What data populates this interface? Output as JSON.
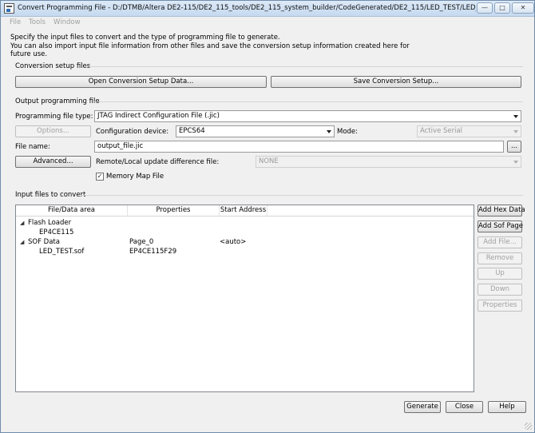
{
  "window": {
    "title": "Convert Programming File - D:/DTMB/Altera DE2-115/DE2_115_tools/DE2_115_system_builder/CodeGenerated/DE2_115/LED_TEST/LED_TEST - LED_T...",
    "minimize": "—",
    "maximize": "□",
    "close": "✕"
  },
  "menu": [
    "File",
    "Tools",
    "Window"
  ],
  "intro": [
    "Specify the input files to convert and the type of programming file to generate.",
    "You can also import input file information from other files and save the conversion setup information created here for",
    "future use."
  ],
  "conversion_setup": {
    "label": "Conversion setup files",
    "open_button": "Open Conversion Setup Data...",
    "save_button": "Save Conversion Setup..."
  },
  "output": {
    "label": "Output programming file",
    "file_type_label": "Programming file type:",
    "file_type_value": "JTAG Indirect Configuration File (.jic)",
    "options_button": "Options...",
    "config_device_label": "Configuration device:",
    "config_device_value": "EPCS64",
    "mode_label": "Mode:",
    "mode_value": "Active Serial",
    "file_name_label": "File name:",
    "file_name_value": "output_file.jic",
    "browse_button": "...",
    "advanced_button": "Advanced...",
    "remote_label": "Remote/Local update difference file:",
    "remote_value": "NONE",
    "memory_map_label": "Memory Map File",
    "memory_map_checked": "✓"
  },
  "input": {
    "label": "Input files to convert",
    "columns": [
      "File/Data area",
      "Properties",
      "Start Address"
    ],
    "rows": [
      {
        "name": "Flash Loader",
        "properties": "",
        "start": "",
        "expander": "◢"
      },
      {
        "name": "EP4CE115",
        "properties": "",
        "start": ""
      },
      {
        "name": "SOF Data",
        "properties": "Page_0",
        "start": "<auto>",
        "expander": "◢"
      },
      {
        "name": "LED_TEST.sof",
        "properties": "EP4CE115F29",
        "start": ""
      }
    ],
    "buttons": {
      "add_hex": "Add Hex Data",
      "add_sof": "Add Sof Page",
      "add_file": "Add File...",
      "remove": "Remove",
      "up": "Up",
      "down": "Down",
      "properties": "Properties"
    }
  },
  "footer": {
    "generate": "Generate",
    "close": "Close",
    "help": "Help"
  }
}
